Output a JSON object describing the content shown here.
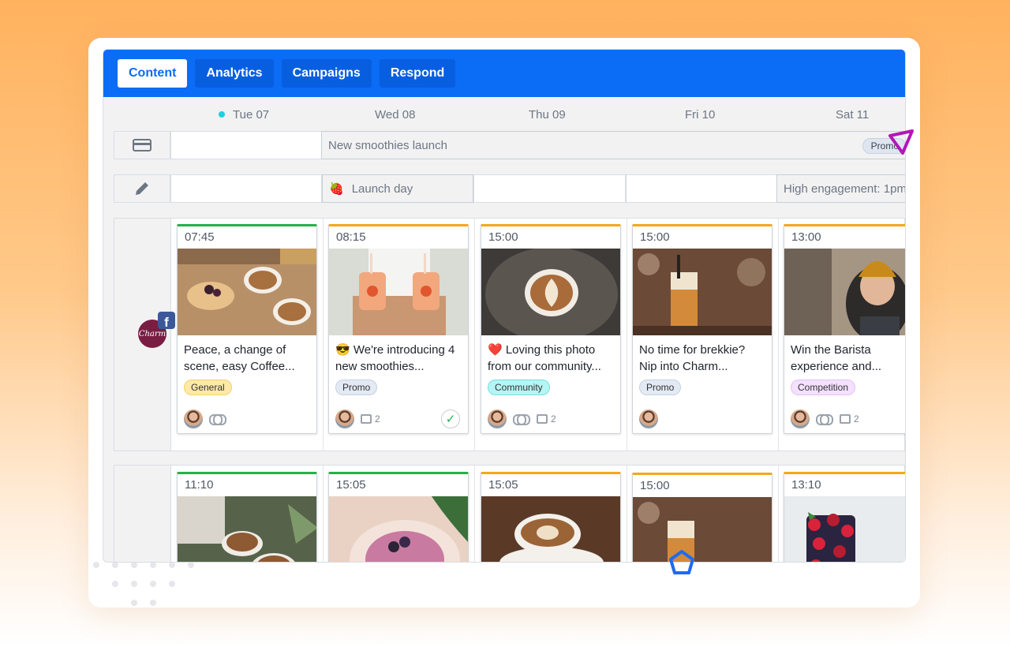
{
  "nav": {
    "tabs": [
      {
        "label": "Content",
        "active": true
      },
      {
        "label": "Analytics",
        "active": false
      },
      {
        "label": "Campaigns",
        "active": false
      },
      {
        "label": "Respond",
        "active": false
      }
    ]
  },
  "calendar": {
    "days": [
      "Tue 07",
      "Wed 08",
      "Thu 09",
      "Fri 10",
      "Sat 11"
    ],
    "today": "Tue 07",
    "campaign_banner": {
      "title": "New smoothies launch",
      "tag": "Promo"
    },
    "notes": [
      {
        "emoji": "🍓",
        "text": "Launch day"
      },
      {
        "text": "High engagement: 1pm"
      }
    ],
    "profile": {
      "name": "Charm",
      "network": "f"
    },
    "row1": [
      {
        "time": "07:45",
        "caption": "Peace, a change of scene, easy Coffee...",
        "tag": "General",
        "comments": "",
        "status": "green"
      },
      {
        "time": "08:15",
        "caption": "😎 We're introducing 4 new smoothies...",
        "tag": "Promo",
        "comments": "2",
        "status": "orange",
        "approved": true
      },
      {
        "time": "15:00",
        "caption": "❤️ Loving this photo from our community...",
        "tag": "Community",
        "comments": "2",
        "status": "orange"
      },
      {
        "time": "15:00",
        "caption": "No time for brekkie? Nip into Charm...",
        "tag": "Promo",
        "comments": "",
        "status": "orange"
      },
      {
        "time": "13:00",
        "caption": "Win the Barista experience and...",
        "tag": "Competition",
        "comments": "2",
        "status": "orange"
      }
    ],
    "row2": [
      {
        "time": "11:10",
        "status": "green"
      },
      {
        "time": "15:05",
        "status": "green"
      },
      {
        "time": "15:05",
        "status": "orange"
      },
      {
        "time": "15:00",
        "status": "orange"
      },
      {
        "time": "13:10",
        "status": "orange"
      }
    ]
  },
  "colors": {
    "brand_blue": "#0b6cf5",
    "approved_green": "#22b24c",
    "pending_orange": "#f2a81d",
    "today_dot": "#1ed0e0"
  }
}
